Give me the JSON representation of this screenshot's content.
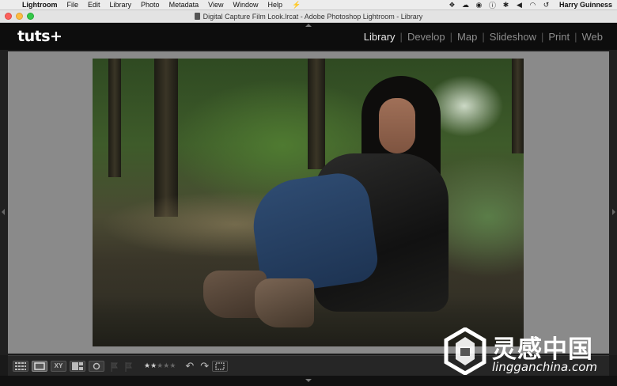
{
  "menubar": {
    "app_name": "Lightroom",
    "items": [
      "File",
      "Edit",
      "Library",
      "Photo",
      "Metadata",
      "View",
      "Window",
      "Help"
    ],
    "user": "Harry Guinness",
    "tray_icons": [
      "dropbox-icon",
      "cloud-icon",
      "creative-cloud-icon",
      "info-icon",
      "bluetooth-icon",
      "volume-icon",
      "wifi-icon",
      "time-machine-icon"
    ]
  },
  "window": {
    "title": "Digital Capture Film Look.lrcat - Adobe Photoshop Lightroom - Library"
  },
  "lightroom": {
    "logo": "tuts+",
    "modules": [
      {
        "label": "Library",
        "active": true
      },
      {
        "label": "Develop",
        "active": false
      },
      {
        "label": "Map",
        "active": false
      },
      {
        "label": "Slideshow",
        "active": false
      },
      {
        "label": "Print",
        "active": false
      },
      {
        "label": "Web",
        "active": false
      }
    ],
    "separator": "|"
  },
  "toolbar": {
    "view_buttons": [
      "grid-view-icon",
      "loupe-view-icon",
      "compare-view-icon",
      "survey-view-icon",
      "people-view-icon"
    ],
    "compare_label": "XY",
    "rating": 2,
    "rating_max": 5,
    "star_char": "★"
  },
  "watermark": {
    "title": "灵感中国",
    "subtitle": "lingganchina.com"
  },
  "colors": {
    "active_module": "#e6e6e6",
    "inactive_module": "#8c8c8c",
    "background": "#8a8a8a"
  }
}
